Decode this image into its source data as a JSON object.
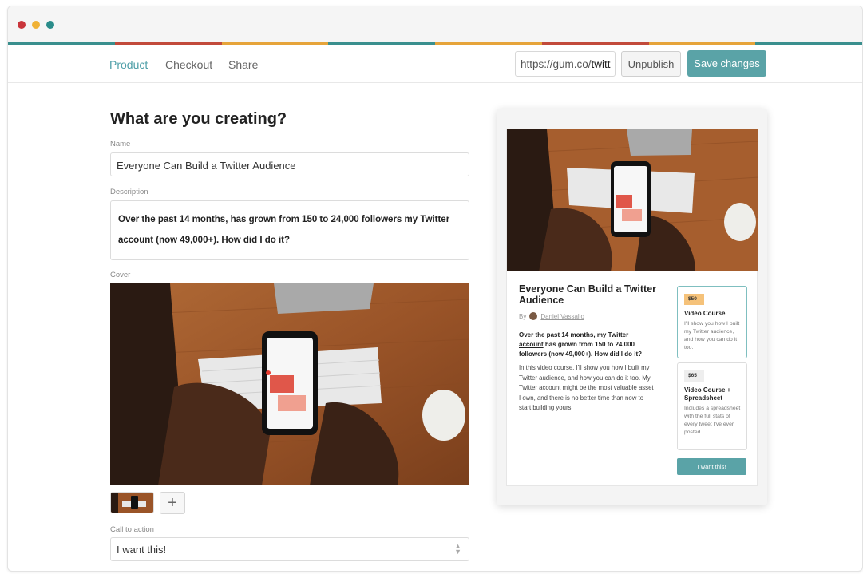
{
  "window": {
    "traffic_lights": [
      "#c9353b",
      "#f0b236",
      "#2a8c8a"
    ],
    "stripe_colors": [
      "#3a8f8e",
      "#c24a3b",
      "#e6a43a",
      "#3a8f8e",
      "#e6a43a",
      "#c24a3b",
      "#e6a43a",
      "#3a8f8e"
    ]
  },
  "nav": {
    "tabs": [
      {
        "label": "Product",
        "active": true
      },
      {
        "label": "Checkout",
        "active": false
      },
      {
        "label": "Share",
        "active": false
      }
    ],
    "url_prefix": "https://gum.co/",
    "url_slug": "twitt",
    "unpublish_label": "Unpublish",
    "save_label": "Save changes"
  },
  "editor": {
    "heading": "What are you creating?",
    "name_label": "Name",
    "name_value": "Everyone Can Build a Twitter Audience",
    "description_label": "Description",
    "description_value": "Over the past 14 months, has grown from 150 to 24,000 followers my Twitter account (now 49,000+). How did I do it?",
    "cover_label": "Cover",
    "add_cover_label": "+",
    "cta_label": "Call to action",
    "cta_value": "I want this!"
  },
  "preview": {
    "title": "Everyone Can Build a Twitter Audience",
    "by_label": "By",
    "author": "Daniel Vassallo",
    "bold_part1": "Over the past 14 months, ",
    "bold_link": "my Twitter account",
    "bold_part2": " has grown from 150 to 24,000 followers (now 49,000+). How did I do it?",
    "body": "In this video course, I'll show you how I built my Twitter audience, and how you can do it too. My Twitter account might be the most valuable asset I own, and there is no better time than now to start building yours.",
    "options": [
      {
        "price": "$50",
        "title": "Video Course",
        "description": "I'll show you how I built my Twitter audience, and how you can do it too.",
        "selected": true,
        "tag_color": "#f5c27a"
      },
      {
        "price": "$65",
        "title": "Video Course + Spreadsheet",
        "description": "Includes a spreadsheet with the full stats of every tweet I've ever posted.",
        "selected": false,
        "tag_color": "#eeeeee"
      }
    ],
    "cta": "I want this!"
  }
}
